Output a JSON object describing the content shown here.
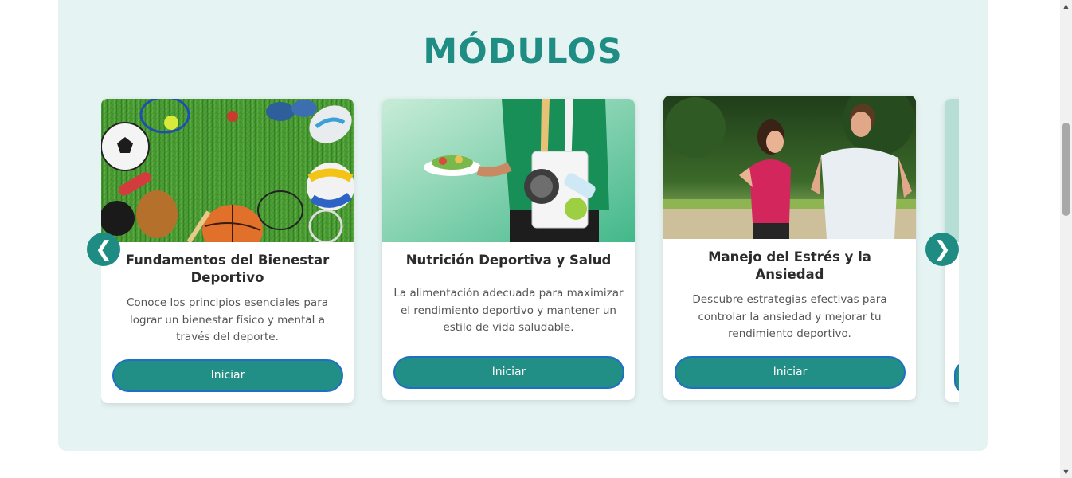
{
  "section": {
    "title": "MÓDULOS"
  },
  "carousel": {
    "prev_icon": "❮",
    "next_icon": "❯",
    "cards": [
      {
        "title": "Fundamentos del Bienestar Deportivo",
        "description": "Conoce los principios esenciales para lograr un bienestar físico y mental a través del deporte.",
        "button": "Iniciar",
        "image": "sports-equipment-photo"
      },
      {
        "title": "Nutrición Deportiva y Salud",
        "description": "La alimentación adecuada para maximizar el rendimiento deportivo y mantener un estilo de vida saludable.",
        "button": "Iniciar",
        "image": "nutrition-athlete-photo"
      },
      {
        "title": "Manejo del Estrés y la Ansiedad",
        "description": "Descubre estrategias efectivas para controlar la ansiedad y mejorar tu rendimiento deportivo.",
        "button": "Iniciar",
        "image": "couple-running-photo"
      }
    ]
  },
  "colors": {
    "accent": "#1f8d84",
    "section_bg": "#e5f4f3",
    "button_border": "#1f6fc2"
  }
}
